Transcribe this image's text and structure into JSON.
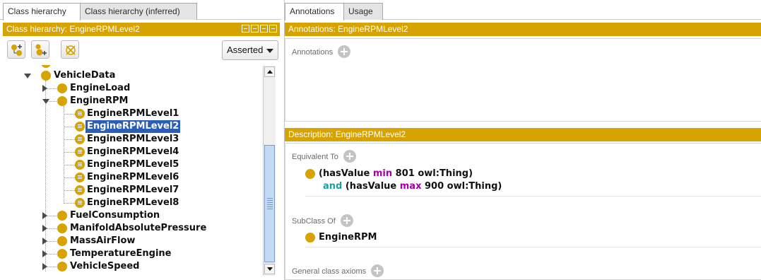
{
  "left_tabs": [
    {
      "label": "Class hierarchy",
      "active": true
    },
    {
      "label": "Class hierarchy (inferred)",
      "active": false
    }
  ],
  "left_panel_title": "Class hierarchy: EngineRPMLevel2",
  "toolbar": {
    "add_subclass_icon": "add-subclass-icon",
    "add_sibling_icon": "add-sibling-icon",
    "delete_class_icon": "delete-class-icon",
    "asserted_label": "Asserted"
  },
  "tree": {
    "root": "VehicleData",
    "items": [
      {
        "label": "EngineLoad"
      },
      {
        "label": "EngineRPM"
      },
      {
        "label": "EngineRPMLevel1"
      },
      {
        "label": "EngineRPMLevel2",
        "selected": true
      },
      {
        "label": "EngineRPMLevel3"
      },
      {
        "label": "EngineRPMLevel4"
      },
      {
        "label": "EngineRPMLevel5"
      },
      {
        "label": "EngineRPMLevel6"
      },
      {
        "label": "EngineRPMLevel7"
      },
      {
        "label": "EngineRPMLevel8"
      },
      {
        "label": "FuelConsumption"
      },
      {
        "label": "ManifoldAbsolutePressure"
      },
      {
        "label": "MassAirFlow"
      },
      {
        "label": "TemperatureEngine"
      },
      {
        "label": "VehicleSpeed"
      }
    ]
  },
  "right_tabs": [
    {
      "label": "Annotations",
      "active": true
    },
    {
      "label": "Usage",
      "active": false
    }
  ],
  "annotations_title": "Annotations: EngineRPMLevel2",
  "annotations_label": "Annotations",
  "description_title": "Description: EngineRPMLevel2",
  "equivalent_to_label": "Equivalent To",
  "equivalent_expr": {
    "line1_open": "(hasValue ",
    "line1_kw": "min",
    "line1_rest": " 801 owl:Thing)",
    "line2_and": "and",
    "line2_open": " (hasValue ",
    "line2_kw": "max",
    "line2_rest": " 900 owl:Thing)"
  },
  "subclass_of_label": "SubClass Of",
  "subclass_of_value": "EngineRPM",
  "general_axioms_label": "General class axioms",
  "colors": {
    "accent_gold": "#d7a300",
    "selection_blue": "#2b5fb7",
    "keyword_purple": "#a400a4",
    "keyword_teal": "#1aa0a0"
  }
}
